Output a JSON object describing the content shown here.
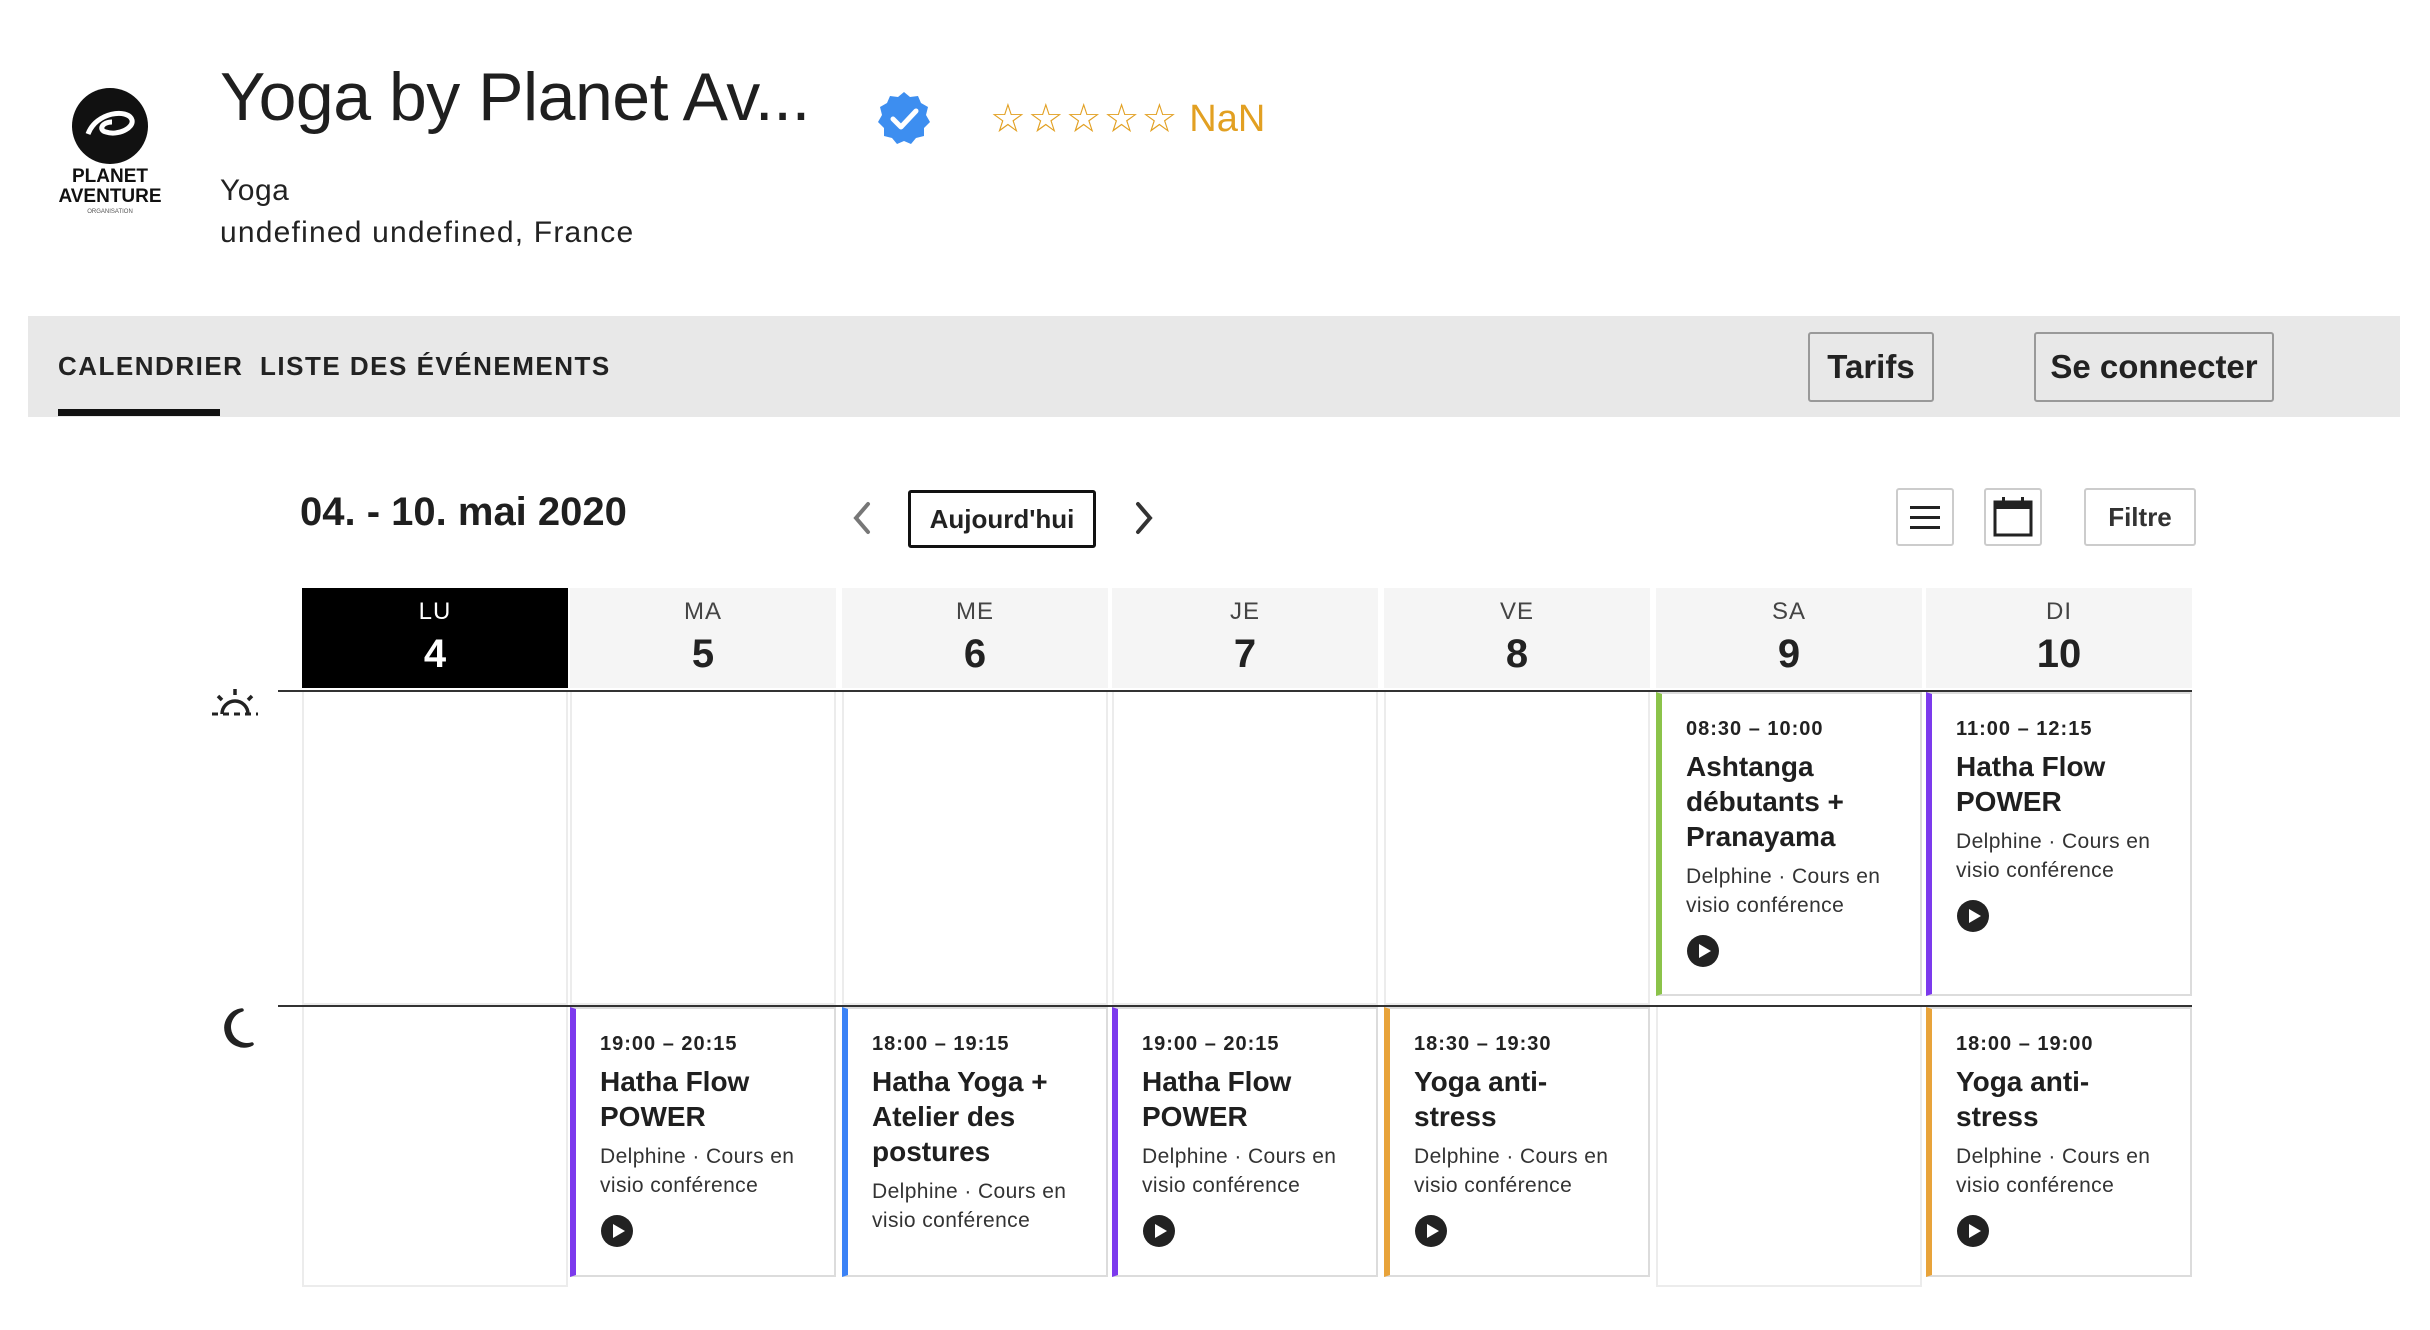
{
  "header": {
    "title": "Yoga by Planet Av...",
    "logo_line1": "PLANET",
    "logo_line2": "AVENTURE",
    "logo_line3": "ORGANISATION",
    "stars": "☆☆☆☆☆",
    "rating": "NaN",
    "category": "Yoga",
    "location": "undefined undefined, France"
  },
  "nav": {
    "tabs": [
      {
        "label": "CALENDRIER"
      },
      {
        "label": "LISTE DES ÉVÉNEMENTS"
      }
    ],
    "tarifs_label": "Tarifs",
    "connect_label": "Se connecter"
  },
  "toolbar": {
    "range": "04. - 10. mai 2020",
    "today_label": "Aujourd'hui",
    "filter_label": "Filtre"
  },
  "days": [
    {
      "abbr": "LU",
      "num": "4"
    },
    {
      "abbr": "MA",
      "num": "5"
    },
    {
      "abbr": "ME",
      "num": "6"
    },
    {
      "abbr": "JE",
      "num": "7"
    },
    {
      "abbr": "VE",
      "num": "8"
    },
    {
      "abbr": "SA",
      "num": "9"
    },
    {
      "abbr": "DI",
      "num": "10"
    }
  ],
  "events": [
    {
      "time": "08:30 – 10:00",
      "title": "Ashtanga débutants + Pranayama",
      "meta": "Delphine · Cours en visio conférence",
      "color": "#8bc34a"
    },
    {
      "time": "11:00 – 12:15",
      "title": "Hatha Flow POWER",
      "meta": "Delphine · Cours en visio conférence",
      "color": "#7c3aed"
    },
    {
      "time": "19:00 – 20:15",
      "title": "Hatha Flow POWER",
      "meta": "Delphine · Cours en visio conférence",
      "color": "#7c3aed"
    },
    {
      "time": "18:00 – 19:15",
      "title": "Hatha Yoga + Atelier des postures",
      "meta": "Delphine · Cours en visio conférence",
      "color": "#3b82f6"
    },
    {
      "time": "19:00 – 20:15",
      "title": "Hatha Flow POWER",
      "meta": "Delphine · Cours en visio conférence",
      "color": "#7c3aed"
    },
    {
      "time": "18:30 – 19:30",
      "title": "Yoga anti-stress",
      "meta": "Delphine · Cours en visio conférence",
      "color": "#e8a33a"
    },
    {
      "time": "18:00 – 19:00",
      "title": "Yoga anti-stress",
      "meta": "Delphine · Cours en visio conférence",
      "color": "#e8a33a"
    }
  ],
  "colors": {
    "accent_star": "#e2a022",
    "verified": "#3d8ef0",
    "active_day": "#000000"
  }
}
